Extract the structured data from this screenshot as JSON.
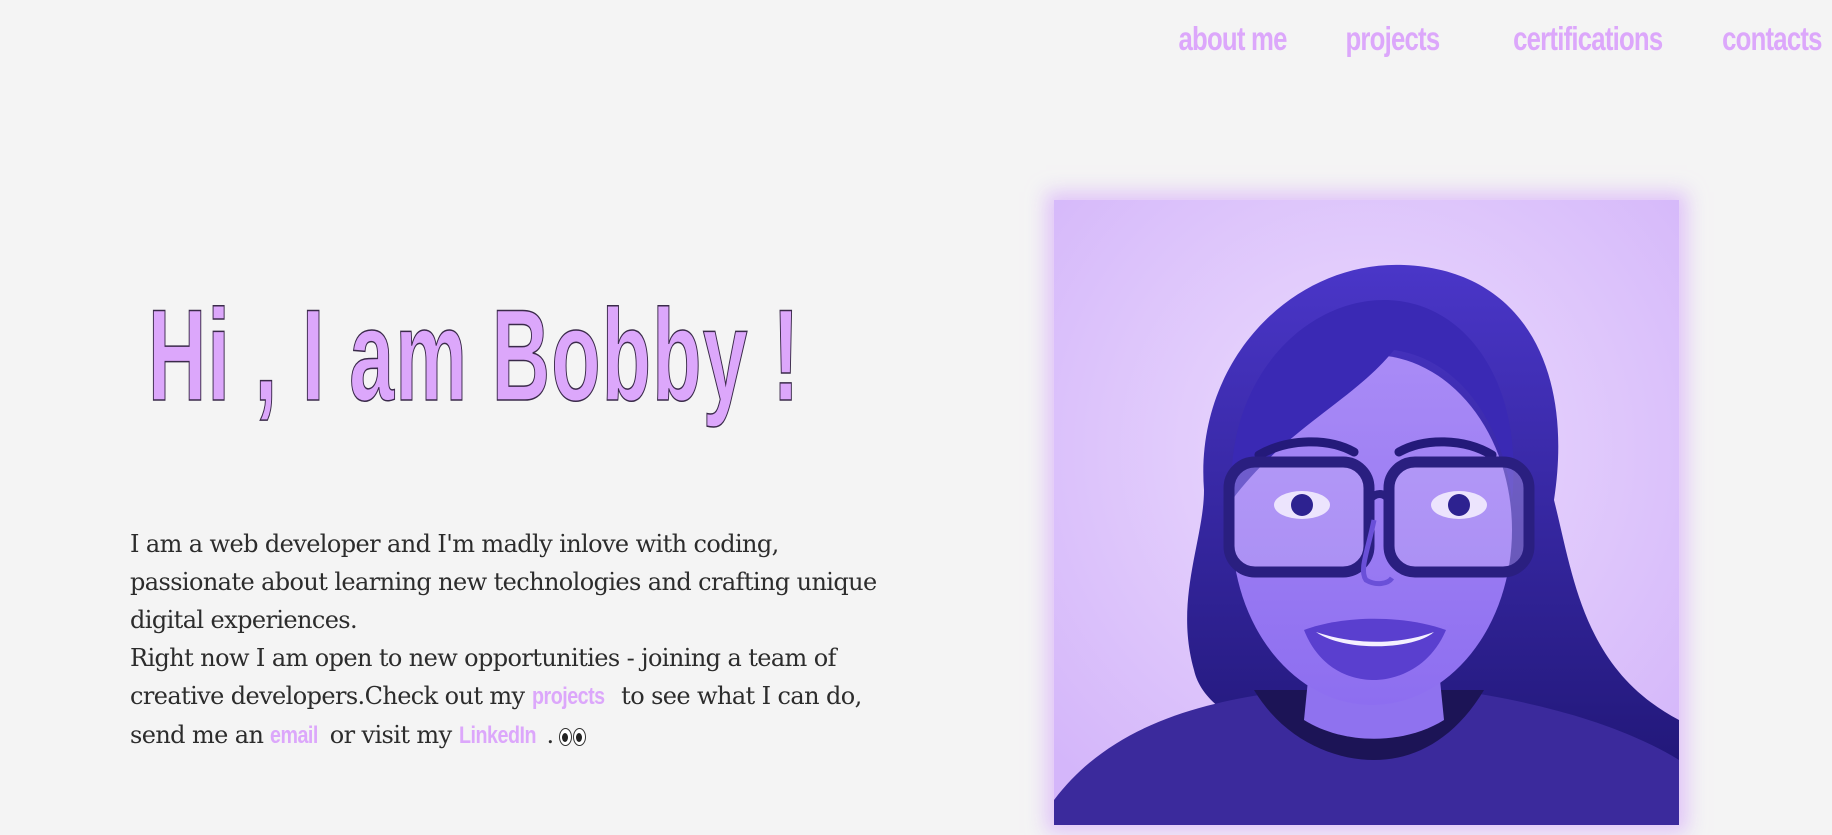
{
  "nav": {
    "items": [
      {
        "label": "about me"
      },
      {
        "label": "projects"
      },
      {
        "label": "certifications"
      },
      {
        "label": "contacts"
      }
    ]
  },
  "hero": {
    "title": "Hi , I am Bobby !"
  },
  "intro": {
    "line1": "I am a web developer and I'm madly inlove with coding, passionate about learning new technologies and crafting unique digital experiences.",
    "line2_before": "Right now I am open to new opportunities - joining a team of creative developers.Check out my ",
    "projects_link": "projects",
    "line2_middle": " to see what I can do, send me an ",
    "email_link": "email",
    "line2_visit": " or visit my ",
    "linkedin_link": "LinkedIn",
    "line2_end": ".",
    "emoji_icon": "eyes-emoji-icon"
  },
  "colors": {
    "background": "#f4f4f4",
    "accent": "#dca7fb",
    "text": "#2c2c2c",
    "portrait_tint": "#8a6cf2"
  }
}
